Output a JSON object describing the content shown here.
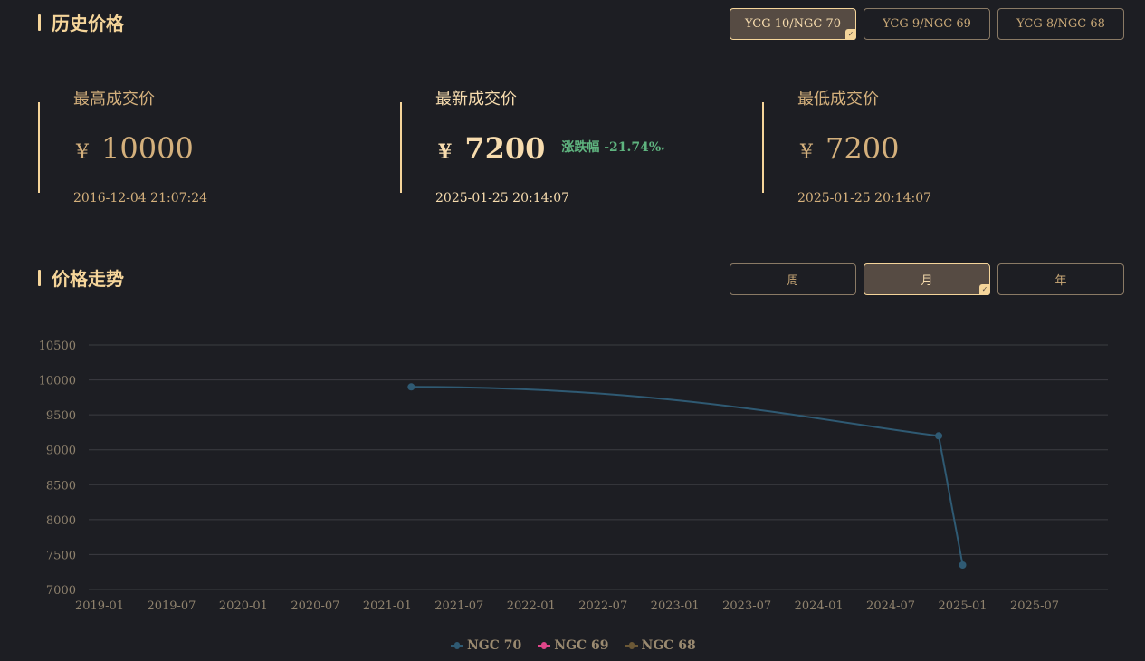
{
  "history": {
    "title": "历史价格",
    "tabs": [
      {
        "label": "YCG 10/NGC 70",
        "active": true
      },
      {
        "label": "YCG 9/NGC 69"
      },
      {
        "label": "YCG 8/NGC 68"
      }
    ]
  },
  "stats": {
    "high": {
      "label": "最高成交价",
      "currency": "¥",
      "price": "10000",
      "time": "2016-12-04 21:07:24"
    },
    "latest": {
      "label": "最新成交价",
      "currency": "¥",
      "price": "7200",
      "change_label": "涨跌幅",
      "change": "-21.74%",
      "change_icon": "▾",
      "time": "2025-01-25 20:14:07"
    },
    "low": {
      "label": "最低成交价",
      "currency": "¥",
      "price": "7200",
      "time": "2025-01-25 20:14:07"
    }
  },
  "trend": {
    "title": "价格走势",
    "tabs": [
      {
        "label": "周"
      },
      {
        "label": "月",
        "active": true
      },
      {
        "label": "年"
      }
    ]
  },
  "colors": {
    "ngc70": "#2f5a73",
    "ngc69": "#e0468a",
    "ngc68": "#6b5836",
    "grid": "#3c3d42"
  },
  "chart_data": {
    "type": "line",
    "xticks": [
      "2019-01",
      "2019-07",
      "2020-01",
      "2020-07",
      "2021-01",
      "2021-07",
      "2022-01",
      "2022-07",
      "2023-01",
      "2023-07",
      "2024-01",
      "2024-07",
      "2025-01",
      "2025-07"
    ],
    "yticks": [
      "10500",
      "10000",
      "9500",
      "9000",
      "8500",
      "8000",
      "7500",
      "7000"
    ],
    "ylim": [
      7000,
      10500
    ],
    "xlim_months": [
      0,
      84
    ],
    "series": [
      {
        "name": "NGC 70",
        "points": [
          {
            "x": "2021-03",
            "m": 26,
            "y": 9900
          },
          {
            "x": "2024-11",
            "m": 70,
            "y": 9200
          },
          {
            "x": "2025-01",
            "m": 72,
            "y": 7350
          }
        ]
      },
      {
        "name": "NGC 69",
        "points": []
      },
      {
        "name": "NGC 68",
        "points": []
      }
    ]
  }
}
